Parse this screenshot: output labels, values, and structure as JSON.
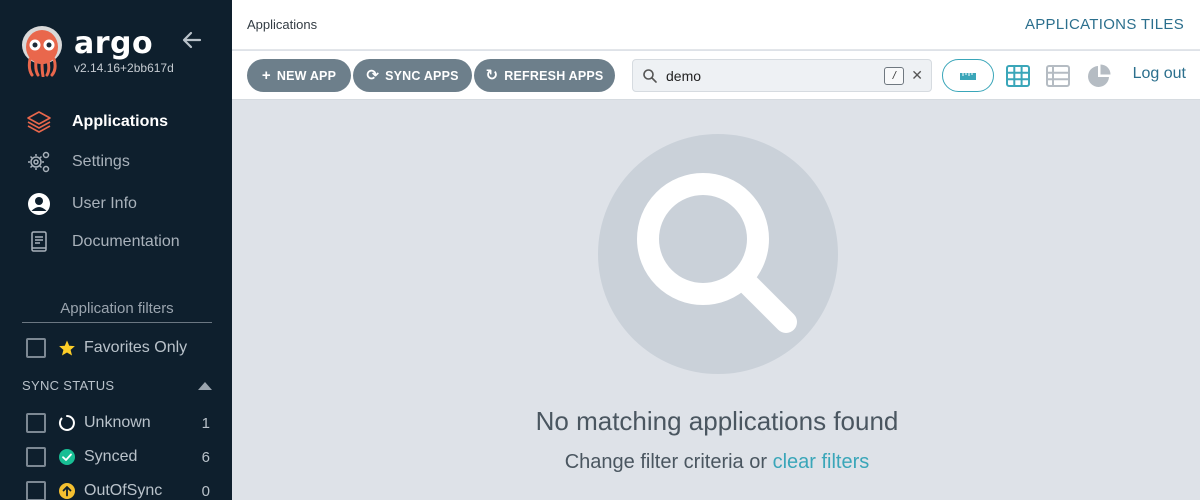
{
  "app": {
    "name": "argo",
    "version": "v2.14.16+2bb617d"
  },
  "sidebar": {
    "nav": [
      {
        "label": "Applications",
        "icon": "layers-icon",
        "active": true
      },
      {
        "label": "Settings",
        "icon": "gears-icon",
        "active": false
      },
      {
        "label": "User Info",
        "icon": "user-circle-icon",
        "active": false
      },
      {
        "label": "Documentation",
        "icon": "book-icon",
        "active": false
      }
    ],
    "filters_title": "Application filters",
    "favorites_label": "Favorites Only",
    "sync_status": {
      "heading": "SYNC STATUS",
      "items": [
        {
          "label": "Unknown",
          "count": "1",
          "icon": "circle-notch-icon"
        },
        {
          "label": "Synced",
          "count": "6",
          "icon": "check-circle-icon"
        },
        {
          "label": "OutOfSync",
          "count": "0",
          "icon": "arrow-up-circle-icon"
        }
      ]
    }
  },
  "header": {
    "breadcrumb": "Applications",
    "page_title": "APPLICATIONS TILES"
  },
  "toolbar": {
    "new_app": "NEW APP",
    "sync_apps": "SYNC APPS",
    "refresh_apps": "REFRESH APPS",
    "search_value": "demo",
    "search_shortcut": "/",
    "logout": "Log out"
  },
  "empty_state": {
    "title": "No matching applications found",
    "subtitle_prefix": "Change filter criteria or",
    "clear_link": "clear filters"
  },
  "colors": {
    "sidebar_bg": "#0e1f2d",
    "accent": "#3aa6b9",
    "button_bg": "#6d7f8b",
    "synced": "#18be94",
    "outofsync": "#f4c030",
    "favorite_star": "#fdce28"
  }
}
